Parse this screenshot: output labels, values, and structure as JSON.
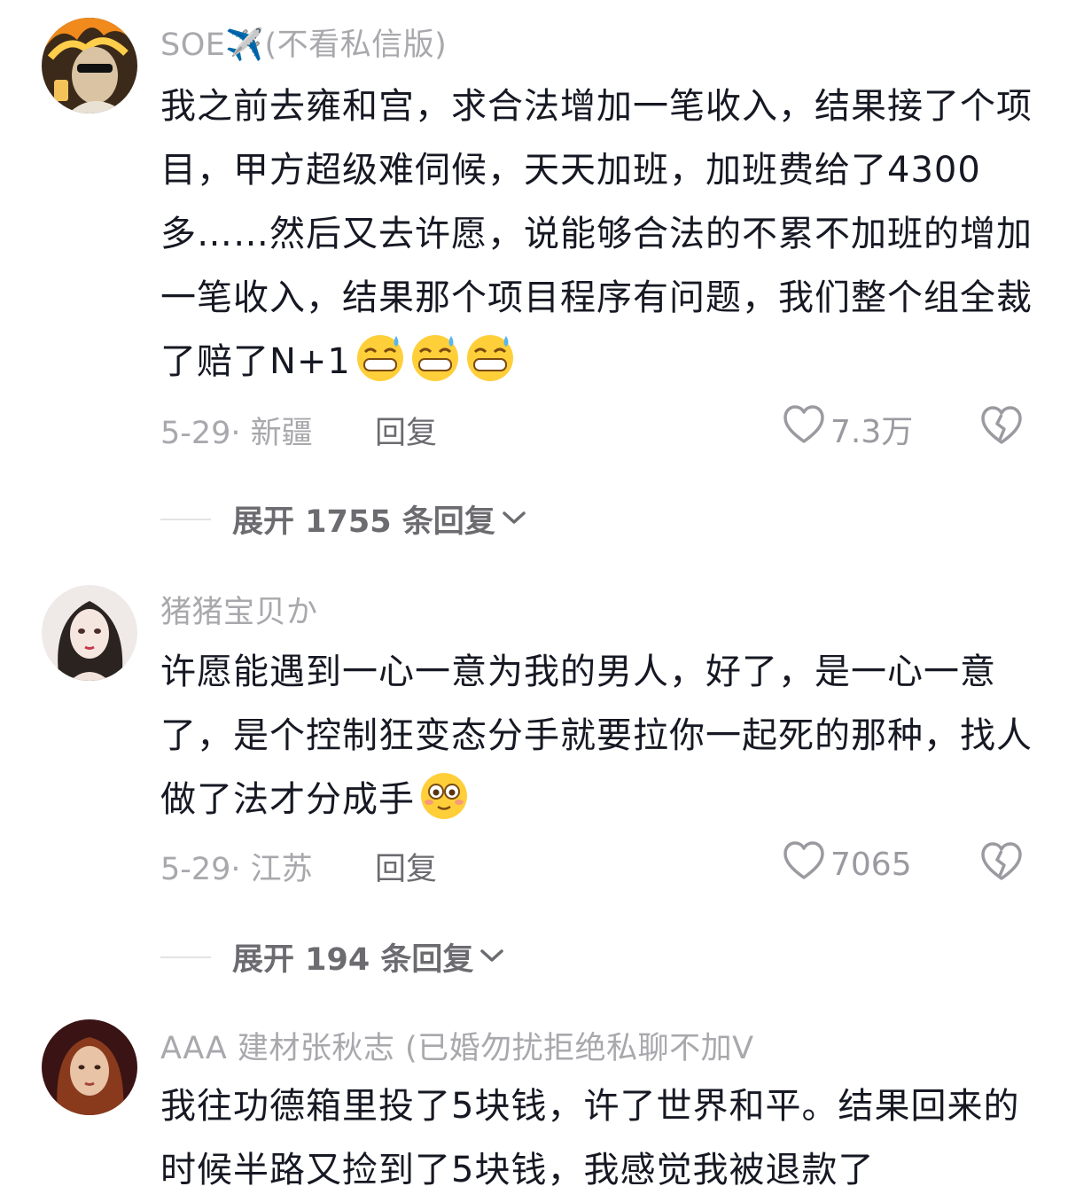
{
  "comments": [
    {
      "username": "SOE✈️(不看私信版)",
      "text": "我之前去雍和宫，求合法增加一笔收入，结果接了个项目，甲方超级难伺候，天天加班，加班费给了4300多……然后又去许愿，说能够合法的不累不加班的增加一笔收入，结果那个项目程序有问题，我们整个组全裁了赔了N+1",
      "emojis": [
        "grin-sweat-emoji",
        "grin-sweat-emoji",
        "grin-sweat-emoji"
      ],
      "date_location": "5-29· 新疆",
      "reply_label": "回复",
      "likes": "7.3万",
      "expand_label": "展开 1755 条回复"
    },
    {
      "username": "猪猪宝贝か",
      "text": "许愿能遇到一心一意为我的男人，好了，是一心一意了，是个控制狂变态分手就要拉你一起死的那种，找人做了法才分成手",
      "emojis": [
        "flushed-emoji"
      ],
      "date_location": "5-29· 江苏",
      "reply_label": "回复",
      "likes": "7065",
      "expand_label": "展开 194 条回复"
    },
    {
      "username": "AAA 建材张秋志 (已婚勿扰拒绝私聊不加V",
      "text": "我往功德箱里投了5块钱，许了世界和平。结果回来的时候半路又捡到了5块钱，我感觉我被退款了"
    }
  ],
  "icons": {
    "like": "heart-outline-icon",
    "dislike": "broken-heart-icon",
    "expand": "chevron-down-icon"
  }
}
